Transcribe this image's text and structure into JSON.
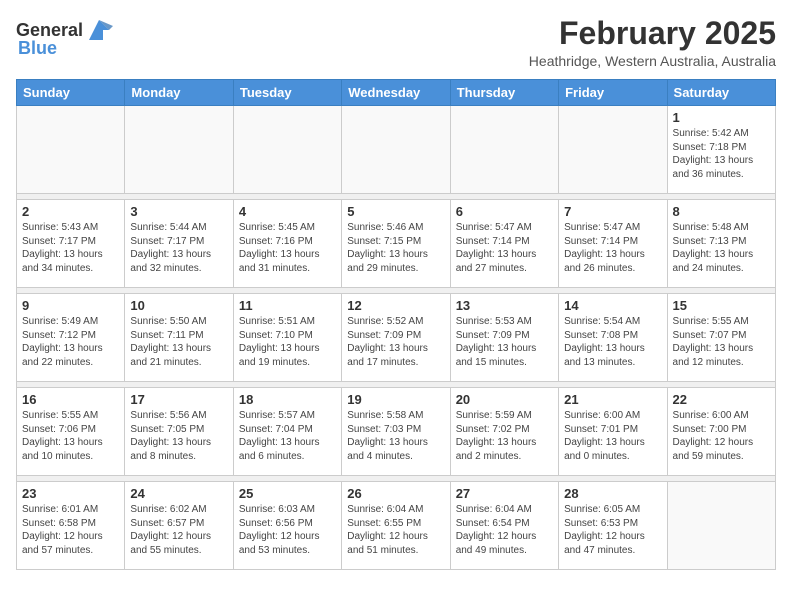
{
  "logo": {
    "general": "General",
    "blue": "Blue"
  },
  "header": {
    "title": "February 2025",
    "subtitle": "Heathridge, Western Australia, Australia"
  },
  "days_of_week": [
    "Sunday",
    "Monday",
    "Tuesday",
    "Wednesday",
    "Thursday",
    "Friday",
    "Saturday"
  ],
  "weeks": [
    [
      {
        "day": "",
        "info": ""
      },
      {
        "day": "",
        "info": ""
      },
      {
        "day": "",
        "info": ""
      },
      {
        "day": "",
        "info": ""
      },
      {
        "day": "",
        "info": ""
      },
      {
        "day": "",
        "info": ""
      },
      {
        "day": "1",
        "info": "Sunrise: 5:42 AM\nSunset: 7:18 PM\nDaylight: 13 hours\nand 36 minutes."
      }
    ],
    [
      {
        "day": "2",
        "info": "Sunrise: 5:43 AM\nSunset: 7:17 PM\nDaylight: 13 hours\nand 34 minutes."
      },
      {
        "day": "3",
        "info": "Sunrise: 5:44 AM\nSunset: 7:17 PM\nDaylight: 13 hours\nand 32 minutes."
      },
      {
        "day": "4",
        "info": "Sunrise: 5:45 AM\nSunset: 7:16 PM\nDaylight: 13 hours\nand 31 minutes."
      },
      {
        "day": "5",
        "info": "Sunrise: 5:46 AM\nSunset: 7:15 PM\nDaylight: 13 hours\nand 29 minutes."
      },
      {
        "day": "6",
        "info": "Sunrise: 5:47 AM\nSunset: 7:14 PM\nDaylight: 13 hours\nand 27 minutes."
      },
      {
        "day": "7",
        "info": "Sunrise: 5:47 AM\nSunset: 7:14 PM\nDaylight: 13 hours\nand 26 minutes."
      },
      {
        "day": "8",
        "info": "Sunrise: 5:48 AM\nSunset: 7:13 PM\nDaylight: 13 hours\nand 24 minutes."
      }
    ],
    [
      {
        "day": "9",
        "info": "Sunrise: 5:49 AM\nSunset: 7:12 PM\nDaylight: 13 hours\nand 22 minutes."
      },
      {
        "day": "10",
        "info": "Sunrise: 5:50 AM\nSunset: 7:11 PM\nDaylight: 13 hours\nand 21 minutes."
      },
      {
        "day": "11",
        "info": "Sunrise: 5:51 AM\nSunset: 7:10 PM\nDaylight: 13 hours\nand 19 minutes."
      },
      {
        "day": "12",
        "info": "Sunrise: 5:52 AM\nSunset: 7:09 PM\nDaylight: 13 hours\nand 17 minutes."
      },
      {
        "day": "13",
        "info": "Sunrise: 5:53 AM\nSunset: 7:09 PM\nDaylight: 13 hours\nand 15 minutes."
      },
      {
        "day": "14",
        "info": "Sunrise: 5:54 AM\nSunset: 7:08 PM\nDaylight: 13 hours\nand 13 minutes."
      },
      {
        "day": "15",
        "info": "Sunrise: 5:55 AM\nSunset: 7:07 PM\nDaylight: 13 hours\nand 12 minutes."
      }
    ],
    [
      {
        "day": "16",
        "info": "Sunrise: 5:55 AM\nSunset: 7:06 PM\nDaylight: 13 hours\nand 10 minutes."
      },
      {
        "day": "17",
        "info": "Sunrise: 5:56 AM\nSunset: 7:05 PM\nDaylight: 13 hours\nand 8 minutes."
      },
      {
        "day": "18",
        "info": "Sunrise: 5:57 AM\nSunset: 7:04 PM\nDaylight: 13 hours\nand 6 minutes."
      },
      {
        "day": "19",
        "info": "Sunrise: 5:58 AM\nSunset: 7:03 PM\nDaylight: 13 hours\nand 4 minutes."
      },
      {
        "day": "20",
        "info": "Sunrise: 5:59 AM\nSunset: 7:02 PM\nDaylight: 13 hours\nand 2 minutes."
      },
      {
        "day": "21",
        "info": "Sunrise: 6:00 AM\nSunset: 7:01 PM\nDaylight: 13 hours\nand 0 minutes."
      },
      {
        "day": "22",
        "info": "Sunrise: 6:00 AM\nSunset: 7:00 PM\nDaylight: 12 hours\nand 59 minutes."
      }
    ],
    [
      {
        "day": "23",
        "info": "Sunrise: 6:01 AM\nSunset: 6:58 PM\nDaylight: 12 hours\nand 57 minutes."
      },
      {
        "day": "24",
        "info": "Sunrise: 6:02 AM\nSunset: 6:57 PM\nDaylight: 12 hours\nand 55 minutes."
      },
      {
        "day": "25",
        "info": "Sunrise: 6:03 AM\nSunset: 6:56 PM\nDaylight: 12 hours\nand 53 minutes."
      },
      {
        "day": "26",
        "info": "Sunrise: 6:04 AM\nSunset: 6:55 PM\nDaylight: 12 hours\nand 51 minutes."
      },
      {
        "day": "27",
        "info": "Sunrise: 6:04 AM\nSunset: 6:54 PM\nDaylight: 12 hours\nand 49 minutes."
      },
      {
        "day": "28",
        "info": "Sunrise: 6:05 AM\nSunset: 6:53 PM\nDaylight: 12 hours\nand 47 minutes."
      },
      {
        "day": "",
        "info": ""
      }
    ]
  ]
}
